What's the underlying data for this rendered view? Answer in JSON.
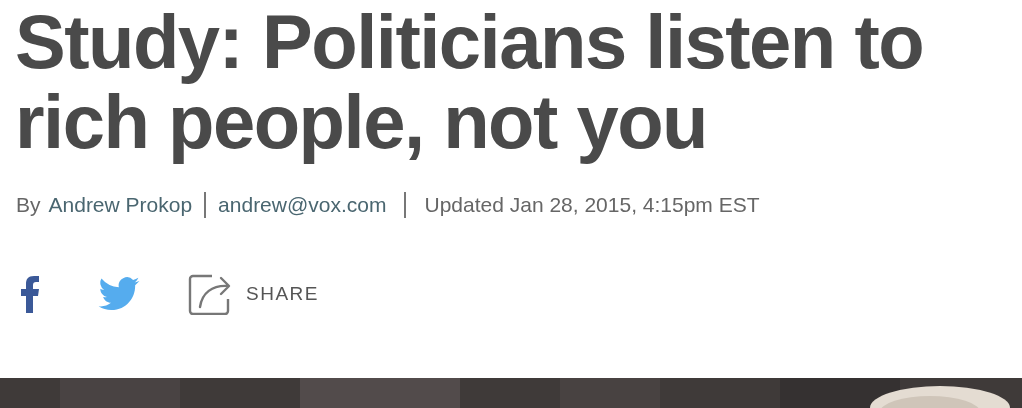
{
  "headline": "Study: Politicians listen to rich people, not you",
  "byline": {
    "prefix": "By",
    "author": "Andrew Prokop",
    "email": "andrew@vox.com",
    "updated": "Updated Jan 28, 2015, 4:15pm EST"
  },
  "share": {
    "label": "SHARE"
  }
}
